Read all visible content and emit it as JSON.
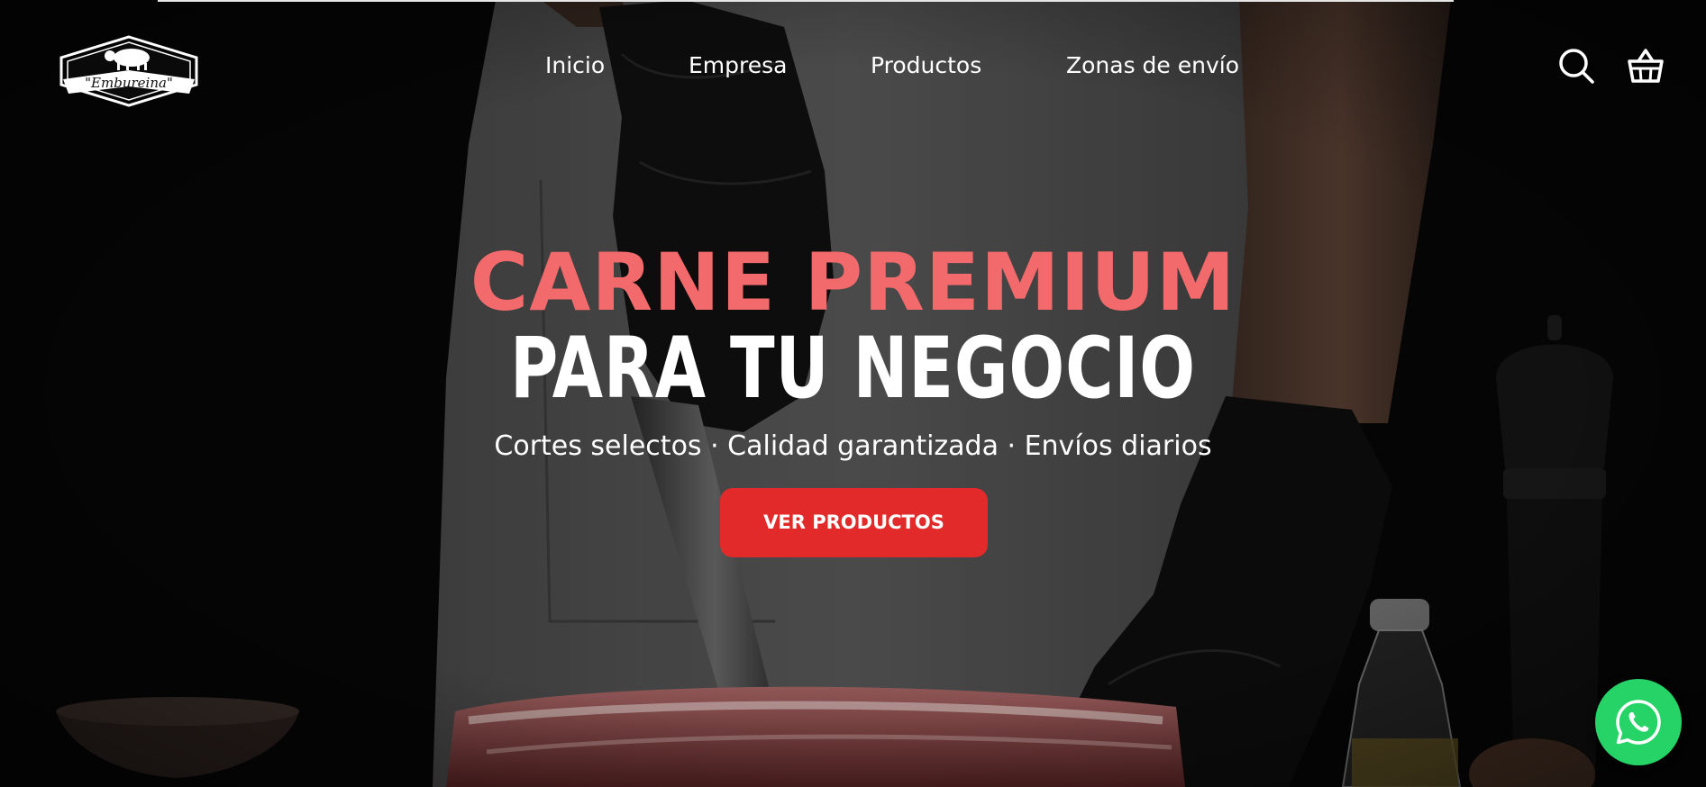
{
  "brand": {
    "logo_text": "\"Embureina\""
  },
  "nav": {
    "items": [
      {
        "label": "Inicio"
      },
      {
        "label": "Empresa"
      },
      {
        "label": "Productos"
      },
      {
        "label": "Zonas de envío"
      }
    ]
  },
  "header_icons": {
    "search": "search-icon",
    "cart": "basket-icon"
  },
  "hero": {
    "headline_line1": "CARNE PREMIUM",
    "headline_line2": "PARA TU NEGOCIO",
    "tagline": "Cortes selectos · Calidad garantizada · Envíos diarios",
    "cta_label": "VER PRODUCTOS"
  },
  "floating": {
    "whatsapp": "whatsapp-icon"
  },
  "colors": {
    "headline_accent": "#f26a6b",
    "cta_background": "#e12a29",
    "whatsapp_green": "#25d366",
    "text": "#ffffff"
  }
}
